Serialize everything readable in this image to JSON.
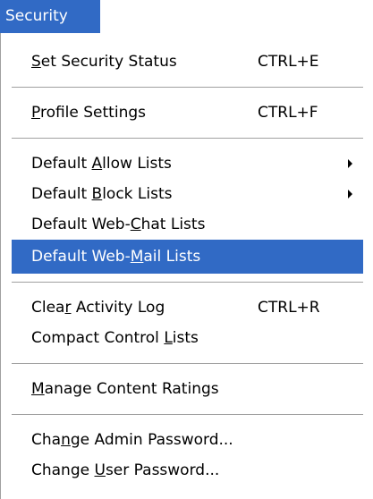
{
  "menu": {
    "title": "Security",
    "items": [
      {
        "pre": "",
        "key": "S",
        "post": "et Security Status",
        "shortcut": "CTRL+E"
      },
      {
        "pre": "",
        "key": "P",
        "post": "rofile Settings",
        "shortcut": "CTRL+F"
      },
      {
        "pre": "Default ",
        "key": "A",
        "post": "llow Lists",
        "submenu": "submenu-arrow"
      },
      {
        "pre": "Default ",
        "key": "B",
        "post": "lock Lists",
        "submenu": "submenu-arrow"
      },
      {
        "pre": "Default Web-",
        "key": "C",
        "post": "hat Lists"
      },
      {
        "pre": "Default Web-",
        "key": "M",
        "post": "ail Lists",
        "selected": true
      },
      {
        "pre": "Clea",
        "key": "r",
        "post": " Activity Log",
        "shortcut": "CTRL+R"
      },
      {
        "pre": "Compact Control ",
        "key": "L",
        "post": "ists"
      },
      {
        "pre": "",
        "key": "M",
        "post": "anage Content Ratings"
      },
      {
        "pre": "Cha",
        "key": "n",
        "post": "ge Admin Password...",
        "shortcut": ""
      },
      {
        "pre": "Change ",
        "key": "U",
        "post": "ser Password..."
      }
    ]
  },
  "colors": {
    "highlight": "#316ac5",
    "highlight_text": "#ffffff",
    "separator": "#a0a0a0"
  }
}
